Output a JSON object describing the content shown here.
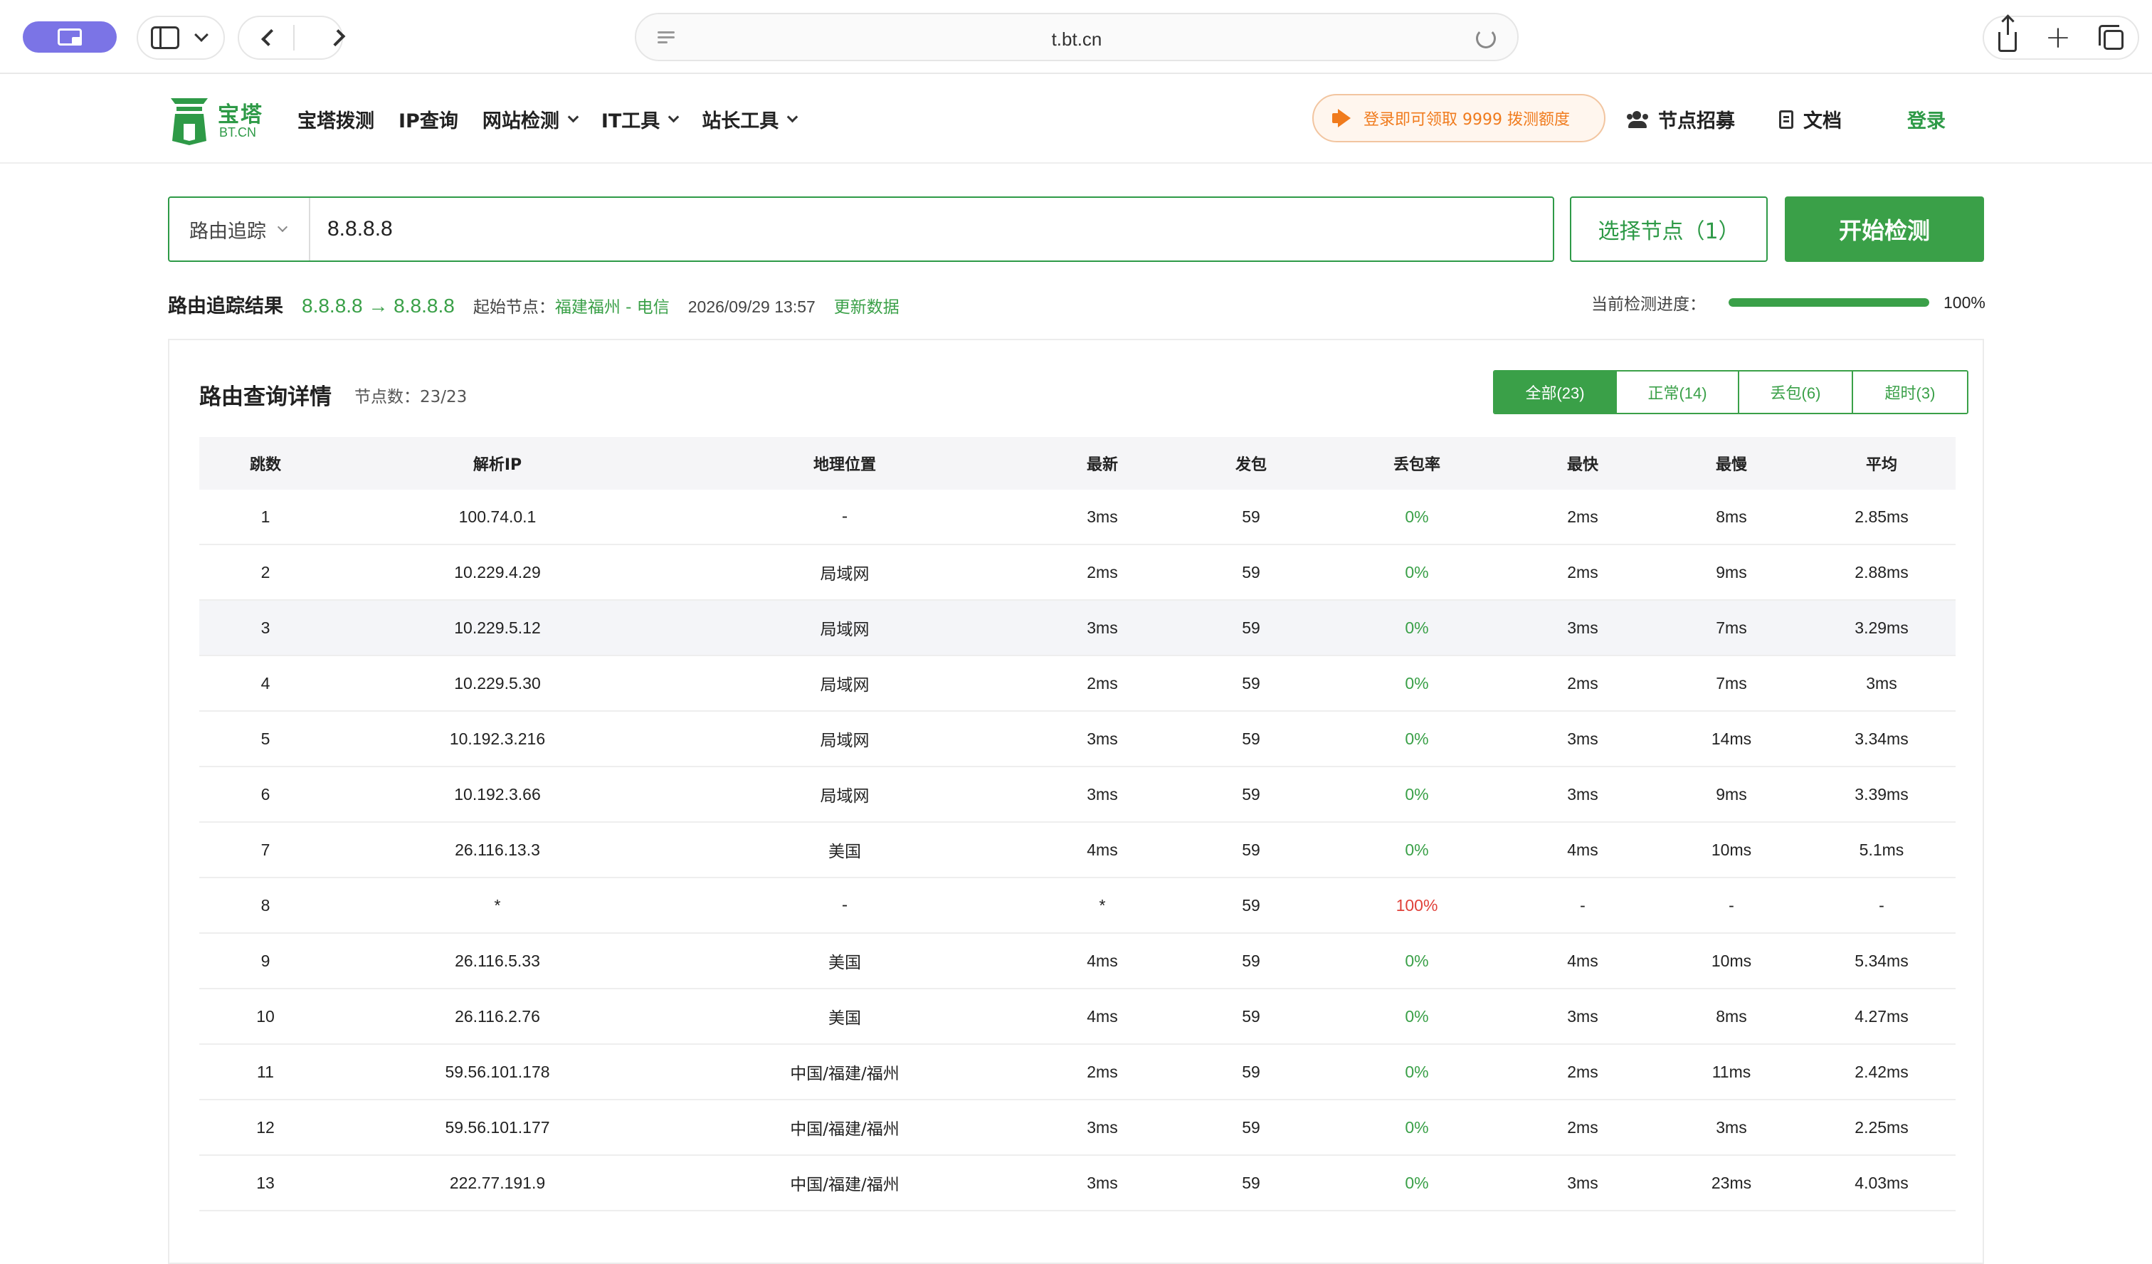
{
  "browser": {
    "url": "t.bt.cn"
  },
  "header": {
    "logo_cn": "宝塔",
    "logo_en": "BT.CN",
    "nav": [
      {
        "label": "宝塔拨测",
        "dropdown": false
      },
      {
        "label": "IP查询",
        "dropdown": false
      },
      {
        "label": "网站检测",
        "dropdown": true
      },
      {
        "label": "IT工具",
        "dropdown": true
      },
      {
        "label": "站长工具",
        "dropdown": true
      }
    ],
    "promo": "登录即可领取 9999 拨测额度",
    "recruit": "节点招募",
    "docs": "文档",
    "login": "登录"
  },
  "search": {
    "type": "路由追踪",
    "value": "8.8.8.8",
    "select_node": "选择节点（1）",
    "start": "开始检测"
  },
  "result": {
    "title": "路由追踪结果",
    "route": "8.8.8.8 → 8.8.8.8",
    "start_node_label": "起始节点：",
    "start_node": "福建福州 - 电信",
    "time": "2026/09/29 13:57",
    "refresh": "更新数据",
    "progress_label": "当前检测进度：",
    "progress_text": "100%",
    "progress_value": 1.0
  },
  "detail": {
    "title": "路由查询详情",
    "count": "节点数：23/23",
    "filters": [
      "全部(23)",
      "正常(14)",
      "丢包(6)",
      "超时(3)"
    ],
    "columns": [
      "跳数",
      "解析IP",
      "地理位置",
      "最新",
      "发包",
      "丢包率",
      "最快",
      "最慢",
      "平均"
    ],
    "rows": [
      [
        "1",
        "100.74.0.1",
        "-",
        "3ms",
        "59",
        "0%",
        "2ms",
        "8ms",
        "2.85ms"
      ],
      [
        "2",
        "10.229.4.29",
        "局域网",
        "2ms",
        "59",
        "0%",
        "2ms",
        "9ms",
        "2.88ms"
      ],
      [
        "3",
        "10.229.5.12",
        "局域网",
        "3ms",
        "59",
        "0%",
        "3ms",
        "7ms",
        "3.29ms"
      ],
      [
        "4",
        "10.229.5.30",
        "局域网",
        "2ms",
        "59",
        "0%",
        "2ms",
        "7ms",
        "3ms"
      ],
      [
        "5",
        "10.192.3.216",
        "局域网",
        "3ms",
        "59",
        "0%",
        "3ms",
        "14ms",
        "3.34ms"
      ],
      [
        "6",
        "10.192.3.66",
        "局域网",
        "3ms",
        "59",
        "0%",
        "3ms",
        "9ms",
        "3.39ms"
      ],
      [
        "7",
        "26.116.13.3",
        "美国",
        "4ms",
        "59",
        "0%",
        "4ms",
        "10ms",
        "5.1ms"
      ],
      [
        "8",
        "*",
        "-",
        "*",
        "59",
        "100%",
        "-",
        "-",
        "-"
      ],
      [
        "9",
        "26.116.5.33",
        "美国",
        "4ms",
        "59",
        "0%",
        "4ms",
        "10ms",
        "5.34ms"
      ],
      [
        "10",
        "26.116.2.76",
        "美国",
        "4ms",
        "59",
        "0%",
        "3ms",
        "8ms",
        "4.27ms"
      ],
      [
        "11",
        "59.56.101.178",
        "中国/福建/福州",
        "2ms",
        "59",
        "0%",
        "2ms",
        "11ms",
        "2.42ms"
      ],
      [
        "12",
        "59.56.101.177",
        "中国/福建/福州",
        "3ms",
        "59",
        "0%",
        "2ms",
        "3ms",
        "2.25ms"
      ],
      [
        "13",
        "222.77.191.9",
        "中国/福建/福州",
        "3ms",
        "59",
        "0%",
        "3ms",
        "23ms",
        "4.03ms"
      ]
    ],
    "highlighted_row": 2
  },
  "colors": {
    "brand_green": "#3aa048",
    "loss_red": "#e0413a",
    "promo_orange": "#f07b1d"
  }
}
